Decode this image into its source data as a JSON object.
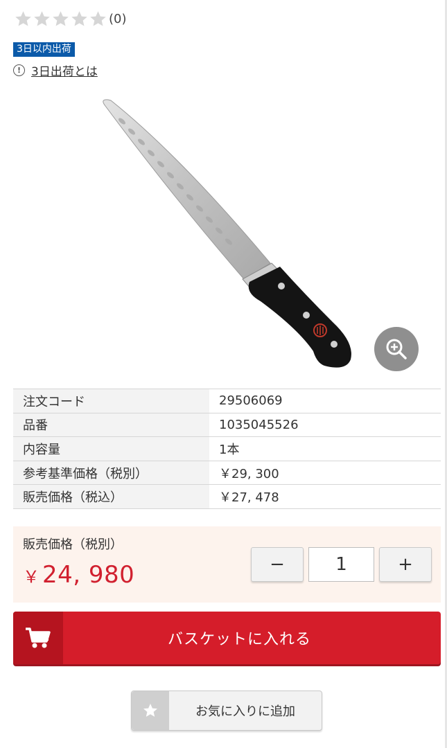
{
  "rating": {
    "stars_filled": 0,
    "stars_total": 5,
    "count_text": "(0)"
  },
  "shipping": {
    "badge": "3日以内出荷",
    "link_text": "3日出荷とは",
    "info_icon": "info-circle-icon"
  },
  "product_image": {
    "alt": "Knife image",
    "zoom_icon": "zoom-in-icon"
  },
  "specs": [
    {
      "label": "注文コード",
      "value": "29506069"
    },
    {
      "label": "品番",
      "value": "1035045526"
    },
    {
      "label": "内容量",
      "value": "1本"
    },
    {
      "label": "参考基準価格（税別）",
      "value": "￥29, 300"
    },
    {
      "label": "販売価格（税込）",
      "value": "￥27, 478"
    }
  ],
  "price": {
    "label": "販売価格（税別）",
    "currency": "￥",
    "amount": "24, 980"
  },
  "quantity": {
    "minus": "−",
    "value": "1",
    "plus": "+"
  },
  "cart_button": {
    "label": "バスケットに入れる",
    "icon": "cart-icon"
  },
  "favorite_button": {
    "label": "お気に入りに追加",
    "icon": "star-icon"
  },
  "colors": {
    "accent_red": "#d51d2a",
    "badge_blue": "#0b5aa9",
    "price_box_bg": "#fdf3ed"
  }
}
